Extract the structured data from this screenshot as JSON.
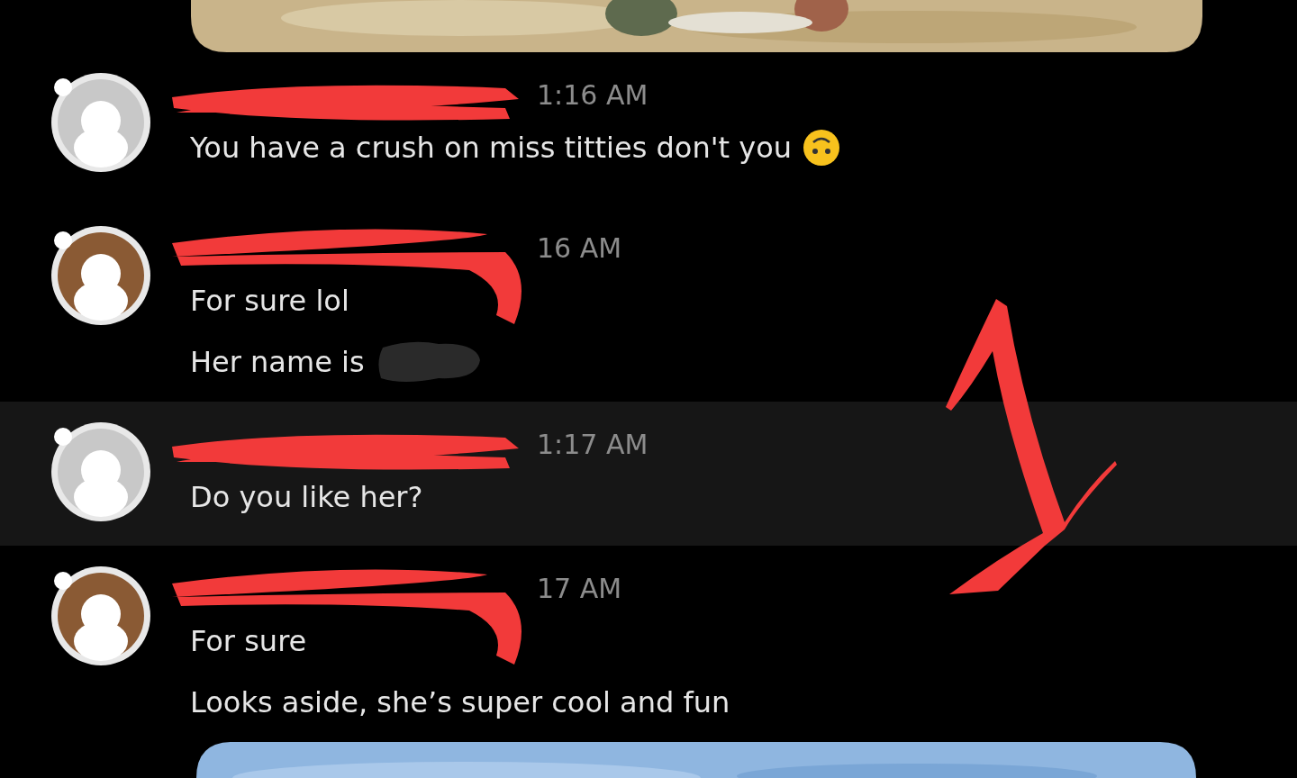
{
  "messages": [
    {
      "color": "#c8c8c8",
      "time": "1:16 AM",
      "name_scribbled": true,
      "highlighted": false,
      "lines": [
        {
          "text": "You have a crush on miss titties don't you",
          "emoji": true,
          "redacted": false
        }
      ]
    },
    {
      "color": "#8a5a34",
      "time": "16 AM",
      "name_scribbled": true,
      "highlighted": false,
      "lines": [
        {
          "text": "For sure lol",
          "emoji": false,
          "redacted": false
        },
        {
          "text": "Her name is",
          "emoji": false,
          "redacted": true
        }
      ]
    },
    {
      "color": "#c8c8c8",
      "time": "1:17 AM",
      "name_scribbled": true,
      "highlighted": true,
      "lines": [
        {
          "text": "Do you like her?",
          "emoji": false,
          "redacted": false
        }
      ]
    },
    {
      "color": "#8a5a34",
      "time": "17 AM",
      "name_scribbled": true,
      "highlighted": false,
      "lines": [
        {
          "text": "For sure",
          "emoji": false,
          "redacted": false
        },
        {
          "text": "Looks aside, she’s super cool and fun",
          "emoji": false,
          "redacted": false
        }
      ]
    }
  ]
}
